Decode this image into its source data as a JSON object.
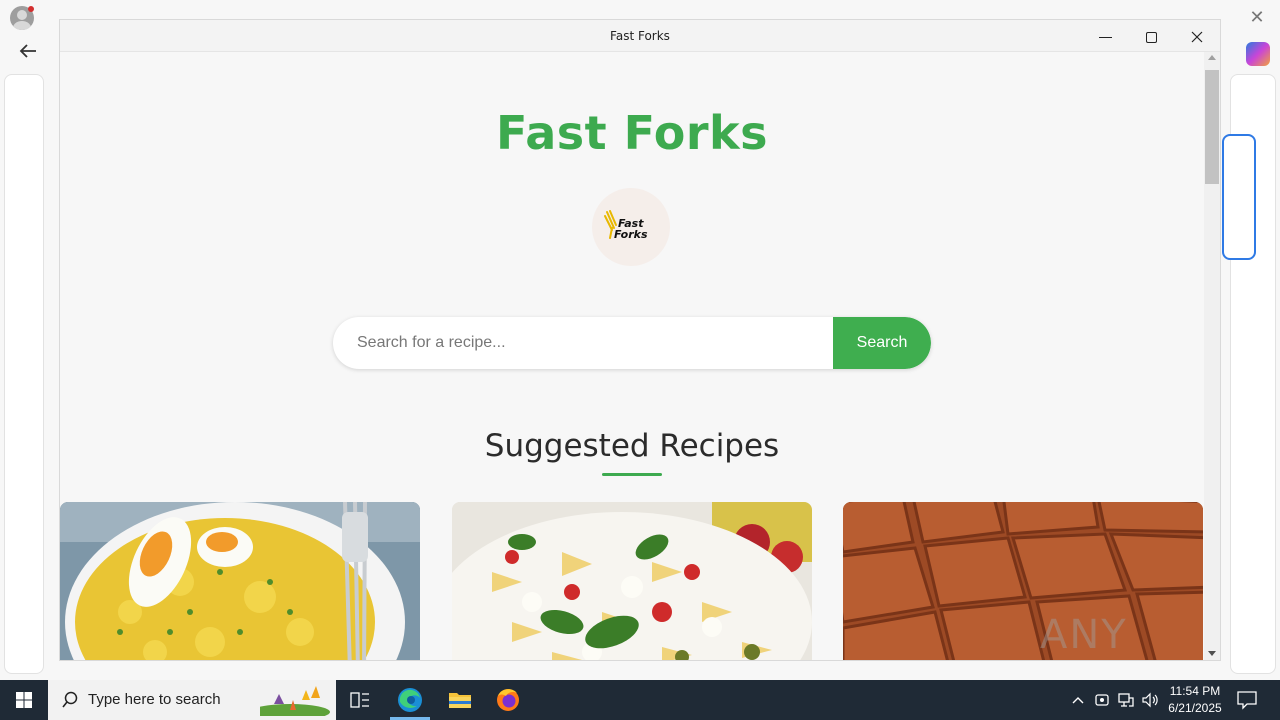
{
  "window": {
    "title": "Fast Forks"
  },
  "site": {
    "title": "Fast Forks",
    "logo_text_line1": "Fast",
    "logo_text_line2": "Forks"
  },
  "search": {
    "placeholder": "Search for a recipe...",
    "button_label": "Search"
  },
  "suggested": {
    "heading": "Suggested Recipes",
    "cards": [
      {
        "image": "egg-rice-photo"
      },
      {
        "image": "pasta-salad-photo"
      },
      {
        "image": "brownies-photo"
      }
    ]
  },
  "watermark": "ANY RUN",
  "taskbar": {
    "search_text": "Type here to search",
    "time": "11:54 PM",
    "date": "6/21/2025"
  },
  "colors": {
    "brand_green": "#3daa4f",
    "taskbar_bg": "#1f2a36"
  }
}
